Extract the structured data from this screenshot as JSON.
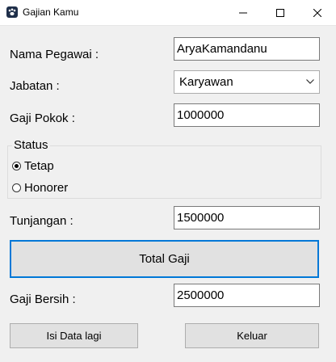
{
  "window": {
    "title": "Gajian Kamu",
    "icon": "paw-icon"
  },
  "form": {
    "nama_label": "Nama Pegawai :",
    "nama_value": "AryaKamandanu",
    "jabatan_label": "Jabatan :",
    "jabatan_value": "Karyawan",
    "gaji_pokok_label": "Gaji Pokok :",
    "gaji_pokok_value": "1000000",
    "status_label": "Status",
    "status_options": [
      {
        "label": "Tetap",
        "selected": true
      },
      {
        "label": "Honorer",
        "selected": false
      }
    ],
    "tunjangan_label": "Tunjangan :",
    "tunjangan_value": "1500000",
    "total_button": "Total Gaji",
    "gaji_bersih_label": "Gaji Bersih :",
    "gaji_bersih_value": "2500000"
  },
  "buttons": {
    "isi_data": "Isi Data lagi",
    "keluar": "Keluar"
  },
  "colors": {
    "accent": "#0078d7",
    "window_bg": "#f0f0f0",
    "button_bg": "#e1e1e1"
  }
}
